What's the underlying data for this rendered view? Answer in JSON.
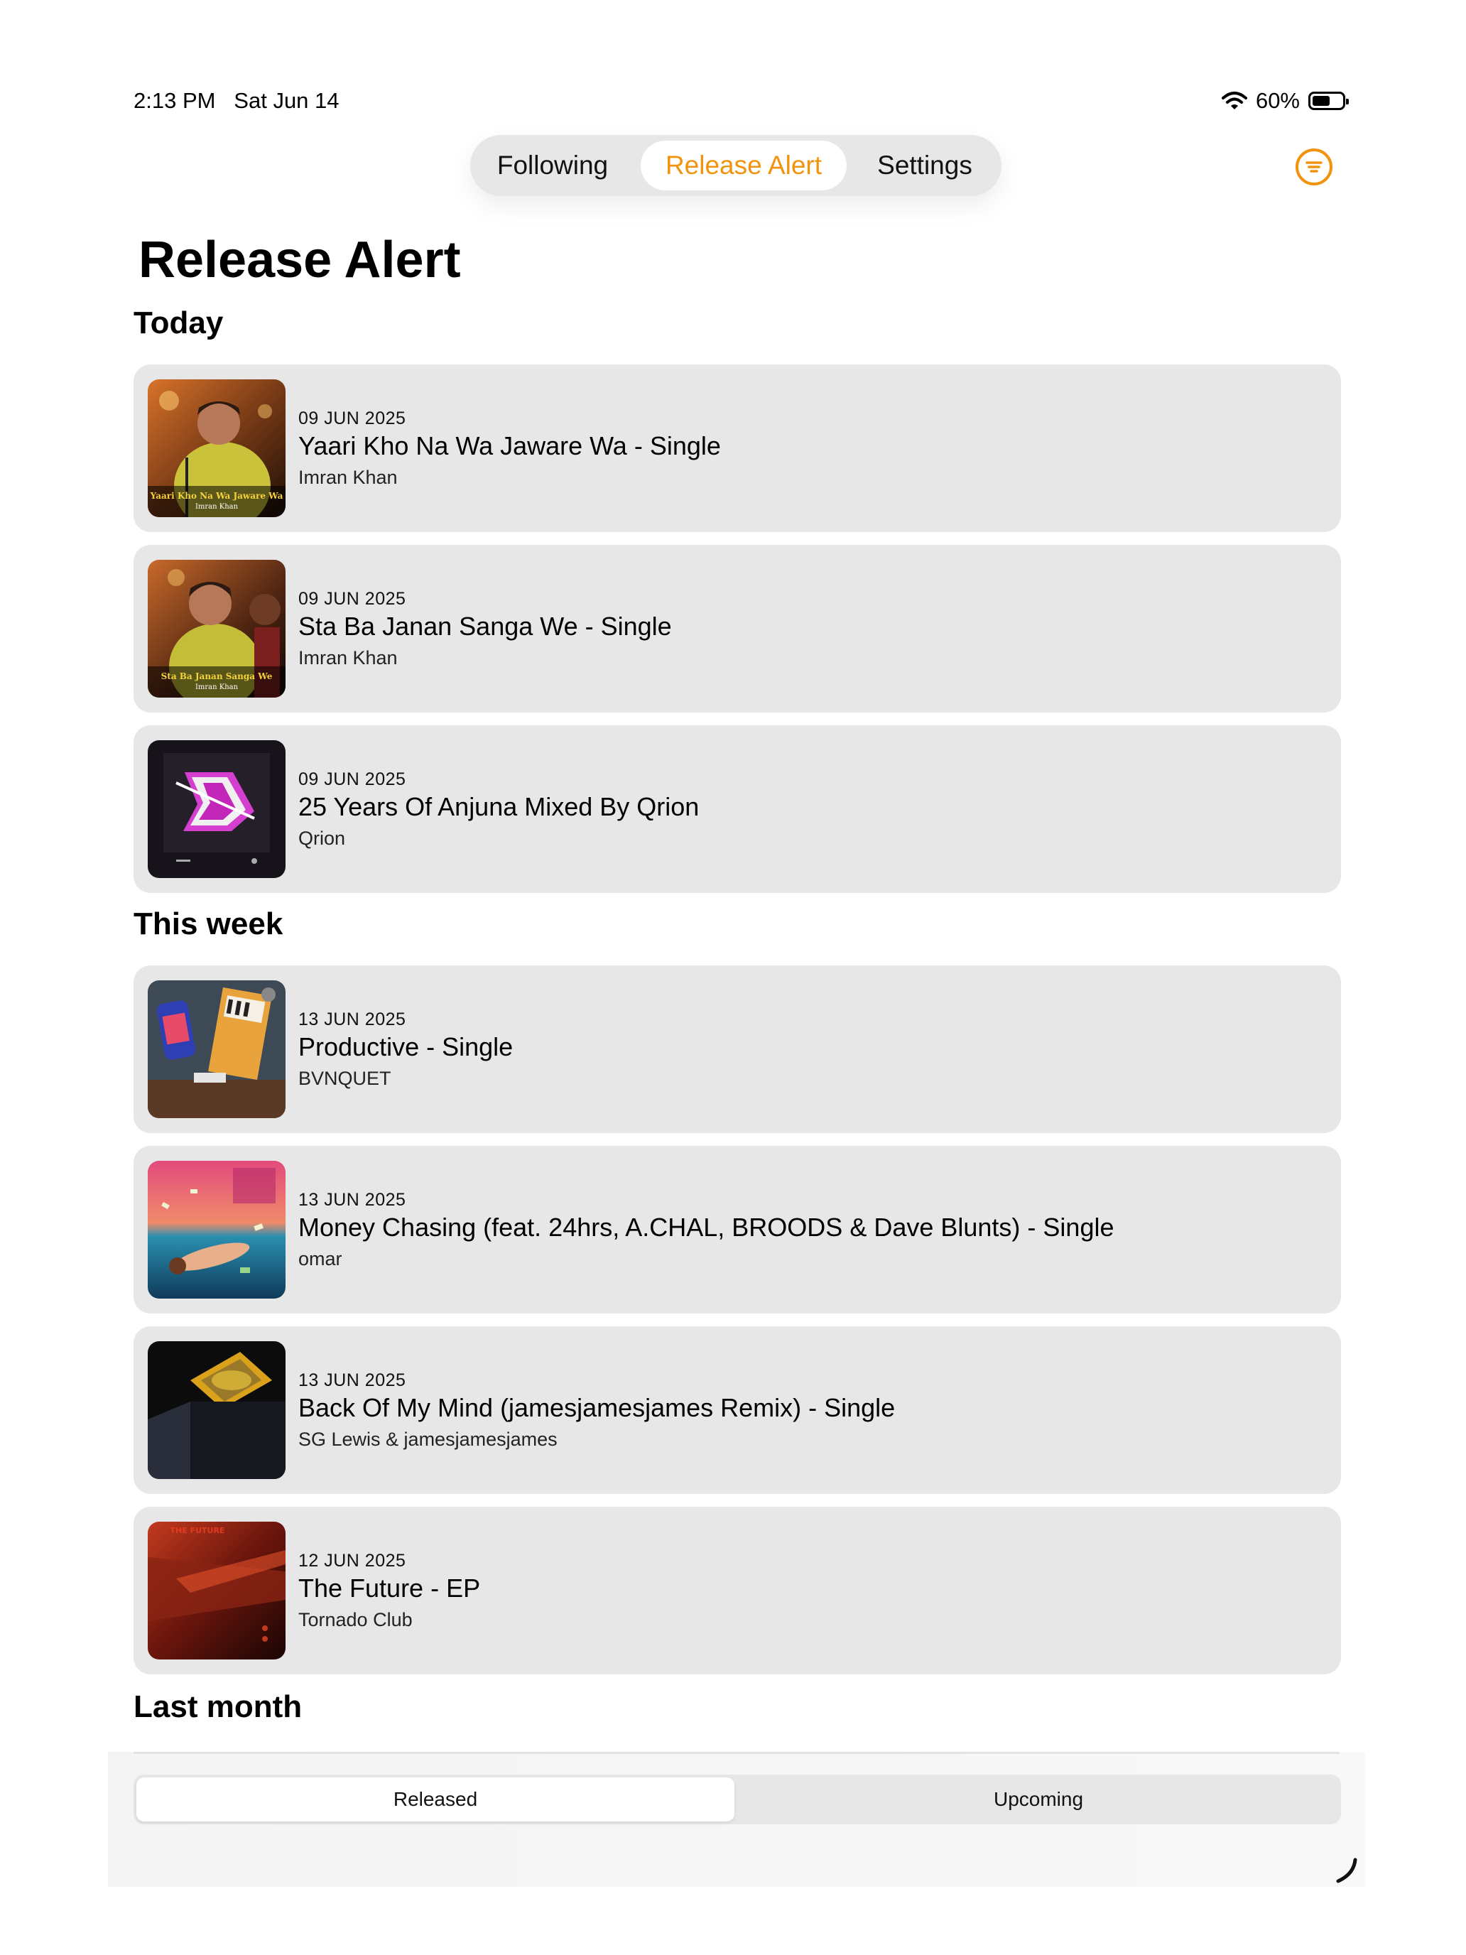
{
  "status": {
    "time": "2:13 PM",
    "date": "Sat Jun 14",
    "battery": "60%",
    "battery_level": 0.6
  },
  "top_tabs": {
    "items": [
      "Following",
      "Release Alert",
      "Settings"
    ],
    "active_index": 1
  },
  "accent_color": "#f2930d",
  "page_title": "Release Alert",
  "sections": [
    {
      "title": "Today"
    },
    {
      "title": "This week"
    },
    {
      "title": "Last month"
    }
  ],
  "releases": [
    {
      "date": "09 JUN 2025",
      "title": "Yaari Kho Na Wa Jaware Wa - Single",
      "artist": "Imran Khan",
      "art_caption": "Yaari Kho Na Wa Jaware Wa",
      "art_artist": "Imran Khan"
    },
    {
      "date": "09 JUN 2025",
      "title": "Sta Ba Janan Sanga We - Single",
      "artist": "Imran Khan",
      "art_caption": "Sta Ba Janan Sanga We",
      "art_artist": "Imran Khan"
    },
    {
      "date": "09 JUN 2025",
      "title": "25 Years Of Anjuna Mixed By Qrion",
      "artist": "Qrion"
    },
    {
      "date": "13 JUN 2025",
      "title": "Productive - Single",
      "artist": "BVNQUET"
    },
    {
      "date": "13 JUN 2025",
      "title": "Money Chasing (feat. 24hrs, A.CHAL, BROODS & Dave Blunts) - Single",
      "artist": "omar"
    },
    {
      "date": "13 JUN 2025",
      "title": "Back Of My Mind (jamesjamesjames Remix) - Single",
      "artist": "SG Lewis & jamesjamesjames"
    },
    {
      "date": "12 JUN 2025",
      "title": "The Future - EP",
      "artist": "Tornado Club",
      "art_caption": "THE FUTURE"
    }
  ],
  "bottom_tabs": {
    "items": [
      "Released",
      "Upcoming"
    ],
    "active_index": 0
  }
}
